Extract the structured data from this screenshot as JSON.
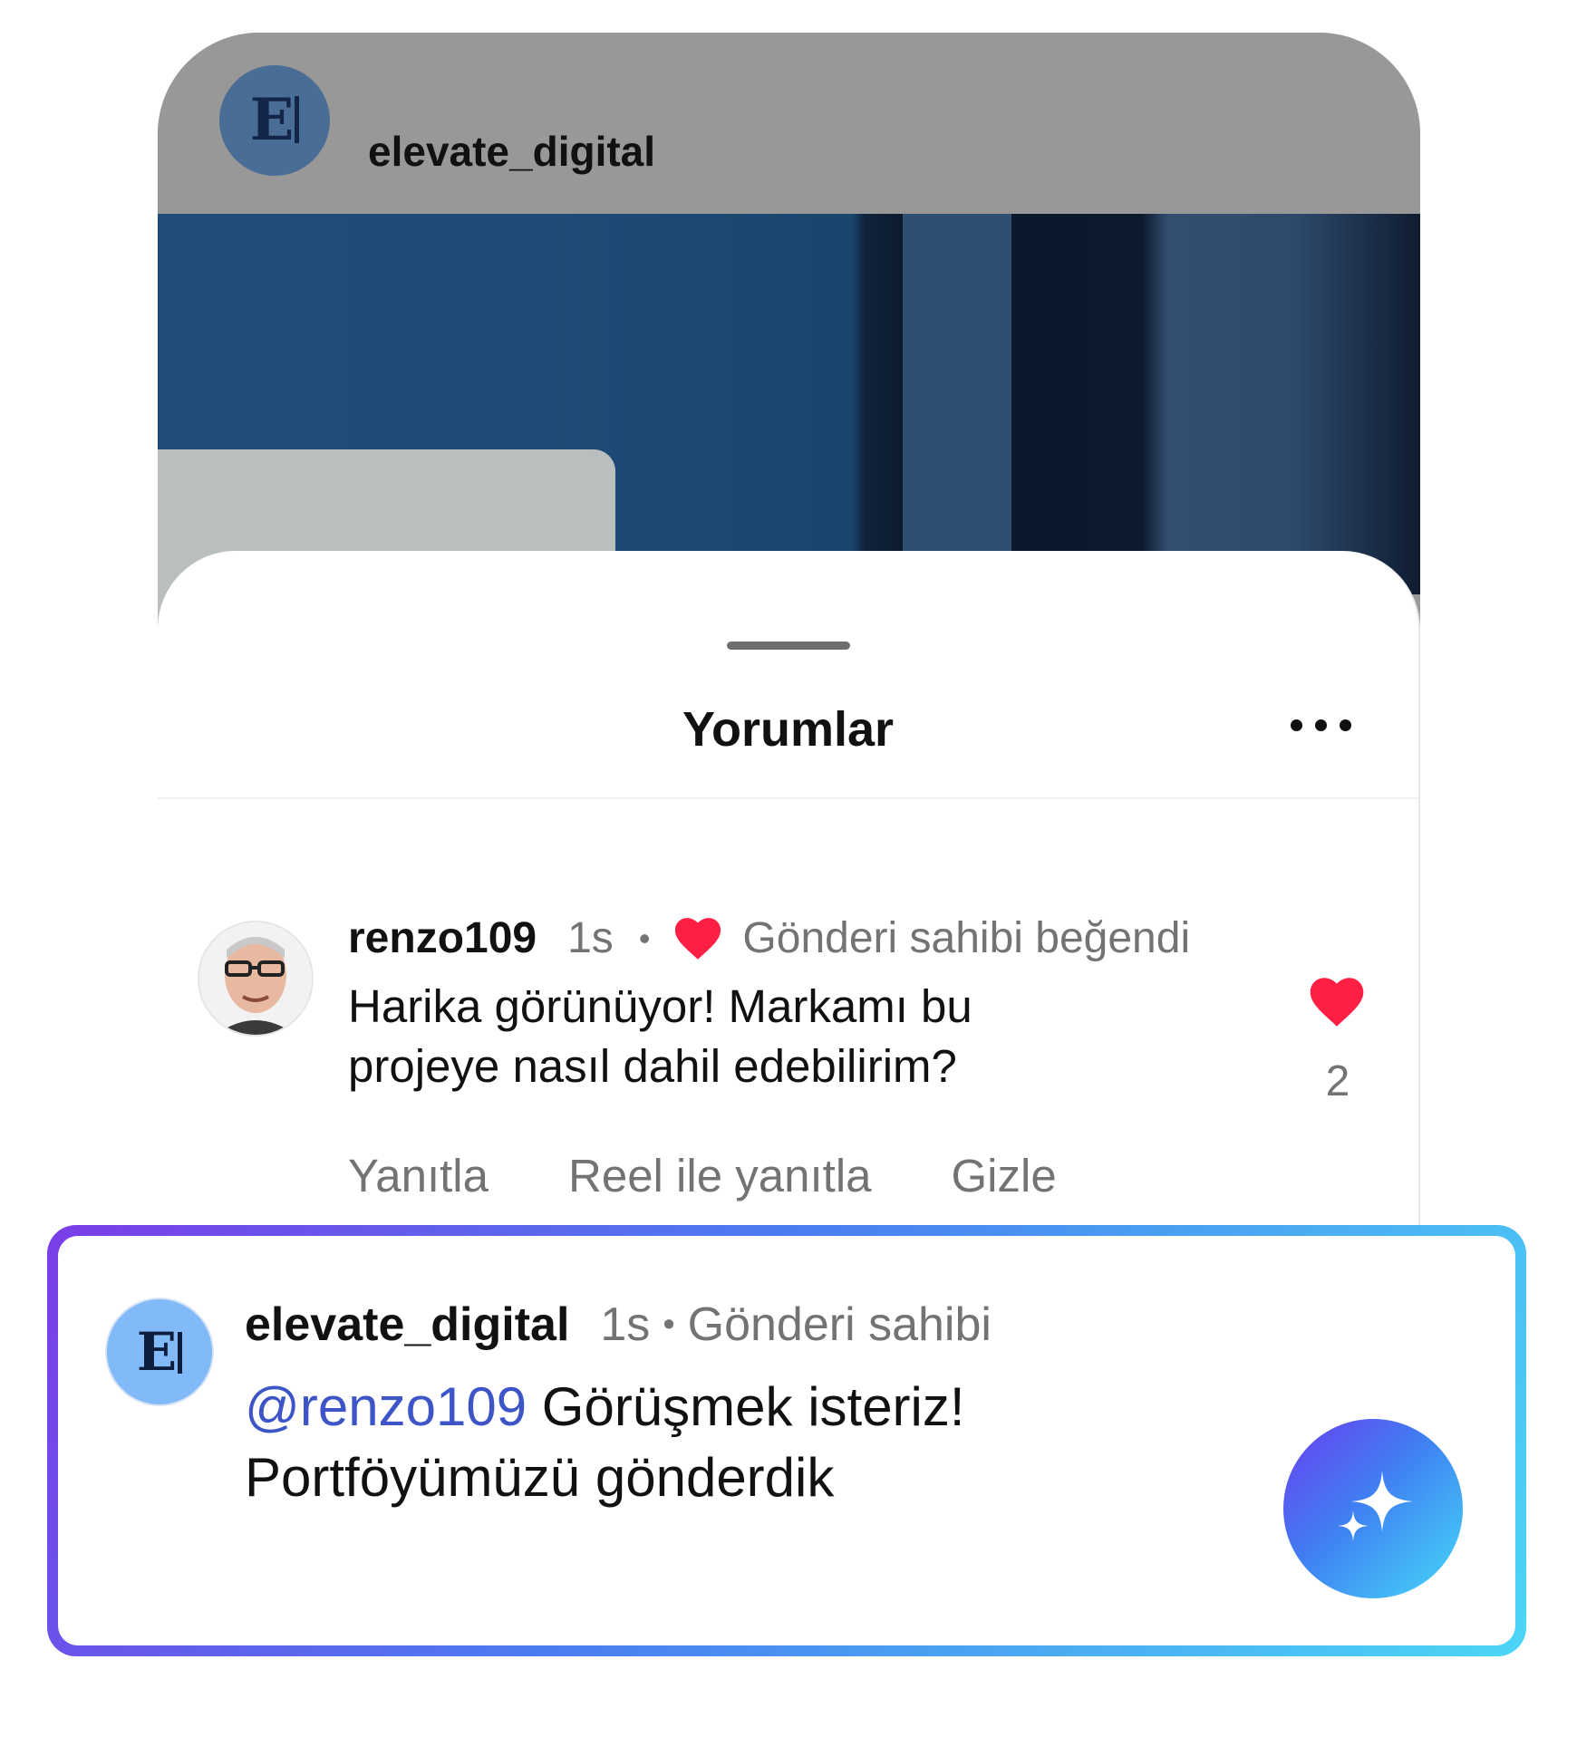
{
  "post": {
    "username": "elevate_digital",
    "avatar_letter": "E"
  },
  "comments_sheet": {
    "title": "Yorumlar",
    "more_icon": "more-horizontal-icon"
  },
  "comment": {
    "username": "renzo109",
    "time": "1s",
    "separator": "•",
    "owner_liked": "Gönderi sahibi beğendi",
    "text": "Harika görünüyor! Markamı bu projeye nasıl dahil edebilirim?",
    "like_count": "2",
    "actions": {
      "reply": "Yanıtla",
      "reel_reply": "Reel ile yanıtla",
      "hide": "Gizle"
    },
    "heart_color": "#ff1f45"
  },
  "reply": {
    "username": "elevate_digital",
    "time": "1s",
    "separator": "•",
    "owner_label": "Gönderi sahibi",
    "mention": "@renzo109",
    "text": " Görüşmek isteriz! Portföyümüzü gönderdik",
    "avatar_letter": "E",
    "ai_icon": "sparkle-icon"
  },
  "colors": {
    "accent_gradient_start": "#7a3de8",
    "accent_gradient_end": "#4bd6f5",
    "mention": "#3d55c7",
    "secondary_text": "#737373"
  }
}
